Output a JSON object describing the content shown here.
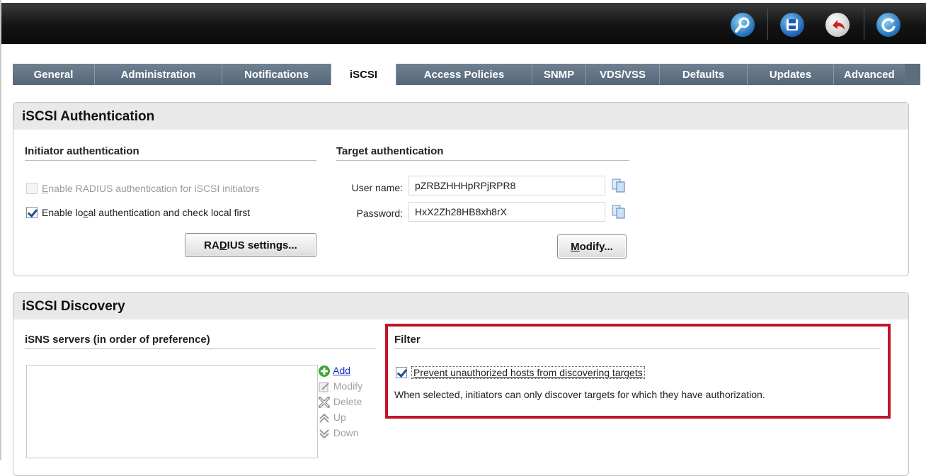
{
  "tabs": [
    "General",
    "Administration",
    "Notifications",
    "iSCSI",
    "Access Policies",
    "SNMP",
    "VDS/VSS",
    "Defaults",
    "Updates",
    "Advanced"
  ],
  "active_tab": "iSCSI",
  "toolbar": {
    "icons": [
      "search-icon",
      "save-icon",
      "undo-icon",
      "refresh-icon"
    ]
  },
  "auth": {
    "title": "iSCSI Authentication",
    "initiator": {
      "heading": "Initiator authentication",
      "radius_checkbox": {
        "pre": "Enable RADIUS authentication for iSCSI initiators",
        "checked": false,
        "enabled": false
      },
      "local_checkbox": {
        "pre": "Enable lo",
        "mnemonic": "c",
        "post": "al authentication and check local first",
        "checked": true
      },
      "radius_button": {
        "pre": "RA",
        "mnemonic": "D",
        "post": "IUS settings..."
      }
    },
    "target": {
      "heading": "Target authentication",
      "username_label": "User name:",
      "username_value": "pZRBZHHHpRPjRPR8",
      "password_label": "Password:",
      "password_value": "HxX2Zh28HB8xh8rX",
      "modify_button": {
        "mnemonic": "M",
        "post": "odify..."
      }
    }
  },
  "discovery": {
    "title": "iSCSI Discovery",
    "isns": {
      "heading": "iSNS servers (in order of preference)",
      "actions": {
        "add": "Add",
        "modify": "Modify",
        "delete": "Delete",
        "up": "Up",
        "down": "Down"
      }
    },
    "filter": {
      "heading": "Filter",
      "checkbox_label": "Prevent unauthorized hosts from discovering targets",
      "checked": true,
      "description": "When selected, initiators can only discover targets for which they have authorization."
    }
  },
  "colors": {
    "highlight": "#c0162c",
    "tab_bg": "#5c6e7e",
    "link": "#1030c0"
  }
}
